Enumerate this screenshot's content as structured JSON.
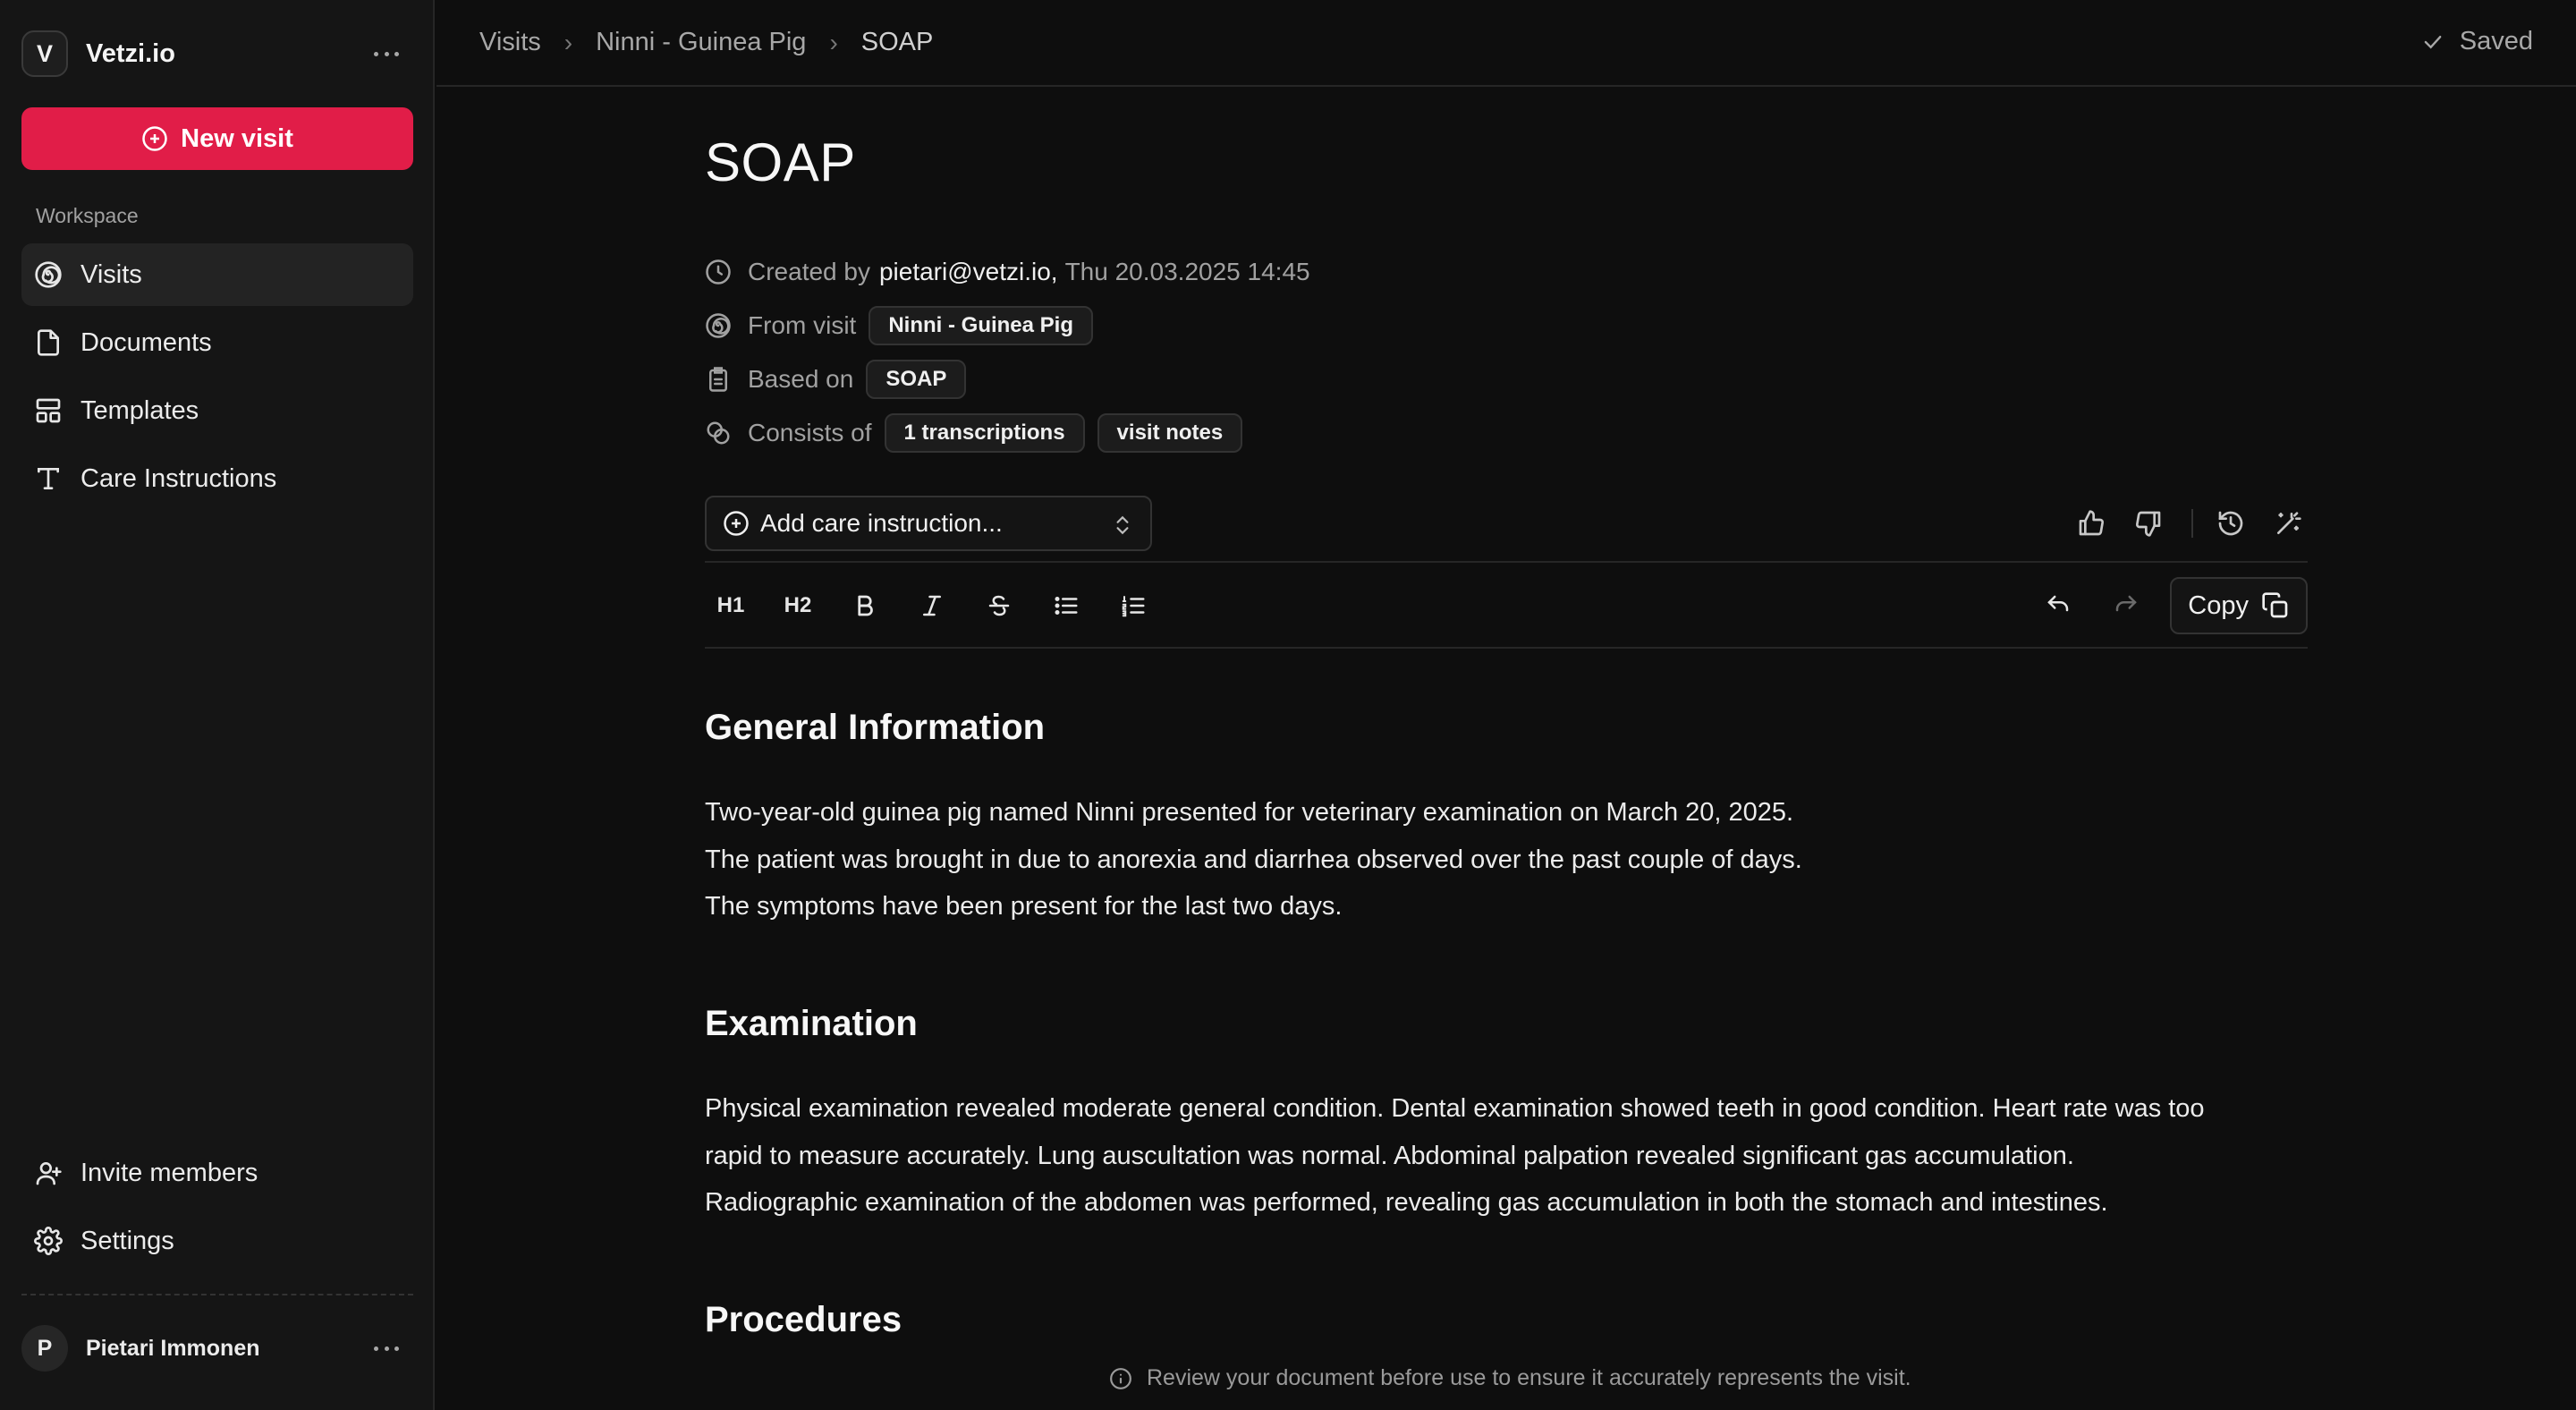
{
  "sidebar": {
    "brand_initial": "V",
    "brand_name": "Vetzi.io",
    "new_visit_label": "New visit",
    "workspace_label": "Workspace",
    "nav": [
      {
        "label": "Visits",
        "icon": "spiral-icon",
        "active": true
      },
      {
        "label": "Documents",
        "icon": "file-icon"
      },
      {
        "label": "Templates",
        "icon": "layout-icon"
      },
      {
        "label": "Care Instructions",
        "icon": "type-icon"
      }
    ],
    "bottom_nav": [
      {
        "label": "Invite members",
        "icon": "user-plus-icon"
      },
      {
        "label": "Settings",
        "icon": "gear-icon"
      }
    ],
    "user_initial": "P",
    "user_name": "Pietari Immonen"
  },
  "topbar": {
    "breadcrumbs": [
      "Visits",
      "Ninni - Guinea Pig",
      "SOAP"
    ],
    "status": "Saved"
  },
  "document": {
    "title": "SOAP",
    "created_prefix": "Created by",
    "created_by": "pietari@vetzi.io,",
    "created_at": "Thu 20.03.2025 14:45",
    "from_visit_label": "From visit",
    "from_visit": "Ninni - Guinea Pig",
    "based_on_label": "Based on",
    "based_on": "SOAP",
    "consists_label": "Consists of",
    "consists": [
      "1 transcriptions",
      "visit notes"
    ],
    "care_placeholder": "Add care instruction...",
    "copy_label": "Copy",
    "toolbar": {
      "h1": "H1",
      "h2": "H2"
    },
    "sections": [
      {
        "heading": "General Information",
        "lines": [
          "Two-year-old guinea pig named Ninni presented for veterinary examination on March 20, 2025.",
          "The patient was brought in due to anorexia and diarrhea observed over the past couple of days.",
          "The symptoms have been present for the last two days."
        ]
      },
      {
        "heading": "Examination",
        "lines": [
          "Physical examination revealed moderate general condition. Dental examination showed teeth in good condition. Heart rate was too",
          "rapid to measure accurately. Lung auscultation was normal. Abdominal palpation revealed significant gas accumulation.",
          "Radiographic examination of the abdomen was performed, revealing gas accumulation in both the stomach and intestines."
        ]
      },
      {
        "heading": "Procedures",
        "lines": []
      }
    ]
  },
  "footer": {
    "disclaimer": "Review your document before use to ensure it accurately represents the visit."
  },
  "colors": {
    "accent": "#e11d48",
    "background": "#0e0e0e",
    "sidebar": "#151515"
  }
}
